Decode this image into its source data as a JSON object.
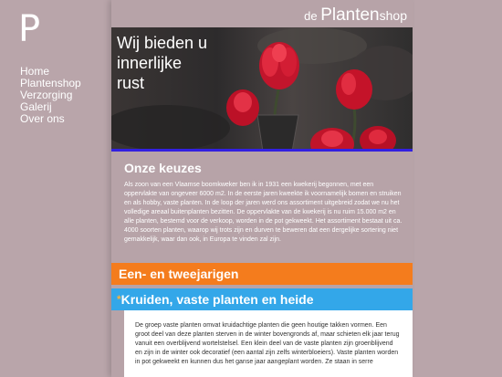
{
  "logo": {
    "letter": "P"
  },
  "nav": {
    "items": [
      "Home",
      "Plantenshop",
      "Verzorging",
      "Galerij",
      "Over ons"
    ]
  },
  "brand": {
    "prefix": "de ",
    "name": "Planten",
    "suffix": "shop"
  },
  "hero": {
    "line1": "Wij bieden u",
    "line2": "innerlijke",
    "line3": "rust"
  },
  "section": {
    "title": "Onze keuzes"
  },
  "intro": {
    "text": "Als zoon van een Vlaamse boomkweker ben ik in 1931 een kwekerij begonnen, met een oppervlakte van ongeveer 6000 m2. In de eerste jaren kweekte ik voornamelijk bomen en struiken en als hobby, vaste planten. In de loop der jaren werd ons assortiment uitgebreid zodat we nu het volledige areaal buitenplanten bezitten. De oppervlakte van de kwekerij is nu ruim 15.000 m2 en alle planten, bestemd voor de verkoop, worden in de pot gekweekt. Het assortiment bestaat uit ca. 4000 soorten planten, waarop wij trots zijn en durven te beweren dat een dergelijke sortering niet gemakkelijk, waar dan ook, in Europa te vinden zal zijn."
  },
  "bars": {
    "first": "Een- en tweejarigen",
    "second_star": "*",
    "second": "Kruiden, vaste planten en heide"
  },
  "panel": {
    "text": "De groep vaste planten omvat kruidachtige planten die geen houtige takken vormen. Een groot deel van deze planten sterven in de winter bovengronds af, maar schieten elk jaar terug vanuit een overblijvend wortelstelsel. Een klein deel van de vaste planten zijn groenblijvend en zijn in de winter ook decoratief (een aantal zijn zelfs winterbloeiers). Vaste planten worden in pot gekweekt en kunnen dus het ganse jaar aangeplant worden. Ze staan in serre"
  },
  "colors": {
    "background": "#b9a5aa",
    "orange_bar": "#f47c1d",
    "blue_bar": "#33a7e9",
    "hero_strip": "#3220e0"
  }
}
